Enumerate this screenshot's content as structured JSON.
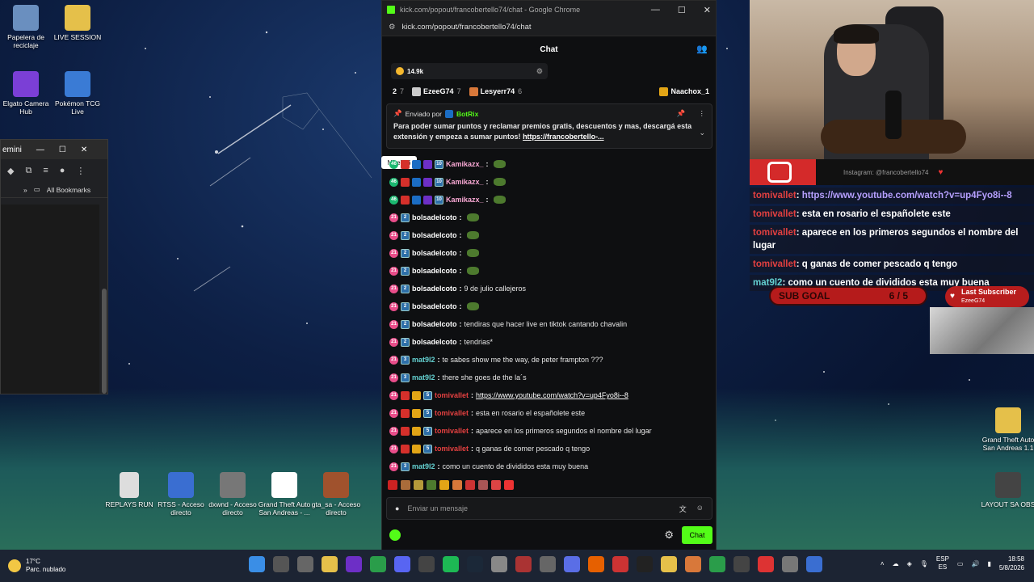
{
  "desktop": {
    "icons_left": [
      {
        "label": "Papelera de reciclaje",
        "color": "#6a8fbf"
      },
      {
        "label": "LIVE SESSION",
        "color": "#e5c04a"
      },
      {
        "label": "Elgato Camera Hub",
        "color": "#7b3fd6"
      },
      {
        "label": "Pokémon TCG Live",
        "color": "#3a7bd5"
      }
    ],
    "icons_bottom": [
      {
        "label": "REPLAYS RUN",
        "color": "#dddddd"
      },
      {
        "label": "RTSS - Acceso directo",
        "color": "#3a6ed1"
      },
      {
        "label": "dxwnd - Acceso directo",
        "color": "#777777"
      },
      {
        "label": "Grand Theft Auto San Andreas - ...",
        "color": "#ffffff"
      },
      {
        "label": "gta_sa - Acceso directo",
        "color": "#a0522d"
      }
    ],
    "icons_right": [
      {
        "label": "Grand Theft Auto San Andreas 1.1",
        "color": "#e5c04a"
      },
      {
        "label": "LAYOUT SA OBS",
        "color": "#444444"
      }
    ]
  },
  "left_browser": {
    "tab_label": "emini",
    "minimize": "—",
    "maximize": "☐",
    "close": "✕",
    "bookmarks_label": "All Bookmarks"
  },
  "chat_window": {
    "title": "kick.com/popout/francobertello74/chat - Google Chrome",
    "url": "kick.com/popout/francobertello74/chat",
    "header": "Chat",
    "points_pill": "14.9k",
    "leaderboard": [
      {
        "rank": "2",
        "name": "",
        "count": "7",
        "badge_color": "#888"
      },
      {
        "rank": "",
        "name": "EzeeG74",
        "count": "7",
        "badge_color": "#ccc"
      },
      {
        "rank": "",
        "name": "Lesyerr74",
        "count": "6",
        "badge_color": "#d8783a"
      },
      {
        "rank": "",
        "name": "Naachox_1",
        "count": "",
        "badge_color": "#e2a516"
      }
    ],
    "pinned": {
      "sent_by_label": "Enviado por",
      "sender": "BotRix",
      "message": "Para poder sumar puntos y reclamar premios gratis, descuentos y mas, descargá esta extensión y empeza a sumar puntos!",
      "link": "https://francobertello-..."
    },
    "tooltip": "Nivel 46",
    "messages": [
      {
        "user": "Kamikazx_",
        "color": "#f9a8d4",
        "text": "",
        "emote": true,
        "level": "10",
        "b1": "b-green",
        "b1t": "46"
      },
      {
        "user": "Kamikazx_",
        "color": "#f9a8d4",
        "text": "",
        "emote": true,
        "level": "10",
        "b1": "b-green",
        "b1t": "46"
      },
      {
        "user": "Kamikazx_",
        "color": "#f9a8d4",
        "text": "",
        "emote": true,
        "level": "10",
        "b1": "b-green",
        "b1t": "46"
      },
      {
        "user": "bolsadelcoto",
        "color": "#ffffff",
        "text": "",
        "emote": true,
        "level": "2",
        "b1": "b-pink",
        "b1t": "21"
      },
      {
        "user": "bolsadelcoto",
        "color": "#ffffff",
        "text": "",
        "emote": true,
        "level": "2",
        "b1": "b-pink",
        "b1t": "21"
      },
      {
        "user": "bolsadelcoto",
        "color": "#ffffff",
        "text": "",
        "emote": true,
        "level": "2",
        "b1": "b-pink",
        "b1t": "21"
      },
      {
        "user": "bolsadelcoto",
        "color": "#ffffff",
        "text": "",
        "emote": true,
        "level": "2",
        "b1": "b-pink",
        "b1t": "21"
      },
      {
        "user": "bolsadelcoto",
        "color": "#ffffff",
        "text": "9 de julio callejeros",
        "emote": false,
        "level": "2",
        "b1": "b-pink",
        "b1t": "21"
      },
      {
        "user": "bolsadelcoto",
        "color": "#ffffff",
        "text": "",
        "emote": true,
        "level": "2",
        "b1": "b-pink",
        "b1t": "21"
      },
      {
        "user": "bolsadelcoto",
        "color": "#ffffff",
        "text": "tendiras que hacer live en tiktok cantando chavalin",
        "emote": false,
        "level": "2",
        "b1": "b-pink",
        "b1t": "21"
      },
      {
        "user": "bolsadelcoto",
        "color": "#ffffff",
        "text": "tendrias*",
        "emote": false,
        "level": "2",
        "b1": "b-pink",
        "b1t": "21"
      },
      {
        "user": "mat9l2",
        "color": "#64d1d1",
        "text": "te sabes show me the way, de peter frampton ???",
        "emote": false,
        "level": "3",
        "b1": "b-pink",
        "b1t": "21"
      },
      {
        "user": "mat9l2",
        "color": "#64d1d1",
        "text": "there she goes de the la´s",
        "emote": false,
        "level": "3",
        "b1": "b-pink",
        "b1t": "21"
      },
      {
        "user": "tomivallet",
        "color": "#e34040",
        "text": "",
        "link": "https://www.youtube.com/watch?v=up4Fyo8i--8",
        "emote": false,
        "level": "5",
        "b1": "b-pink",
        "b1t": "21"
      },
      {
        "user": "tomivallet",
        "color": "#e34040",
        "text": "esta en rosario el españolete este",
        "emote": false,
        "level": "5",
        "b1": "b-pink",
        "b1t": "21"
      },
      {
        "user": "tomivallet",
        "color": "#e34040",
        "text": "aparece en los primeros segundos el nombre del lugar",
        "emote": false,
        "level": "5",
        "b1": "b-pink",
        "b1t": "21"
      },
      {
        "user": "tomivallet",
        "color": "#e34040",
        "text": "q ganas de comer pescado q tengo",
        "emote": false,
        "level": "5",
        "b1": "b-pink",
        "b1t": "21"
      },
      {
        "user": "mat9l2",
        "color": "#64d1d1",
        "text": "como un cuento de divididos esta muy buena",
        "emote": false,
        "level": "3",
        "b1": "b-pink",
        "b1t": "21"
      }
    ],
    "input_placeholder": "Enviar un mensaje",
    "send_label": "Chat"
  },
  "stream_overlay": {
    "instagram": "Instagram: @francobertello74",
    "chat": [
      {
        "user": "tomivallet",
        "text": "",
        "link": "https://www.youtube.com/watch?v=up4Fyo8i--8"
      },
      {
        "user": "tomivallet",
        "text": "esta en rosario el españolete este"
      },
      {
        "user": "tomivallet",
        "text": "aparece en los primeros segundos el nombre del lugar"
      },
      {
        "user": "tomivallet",
        "text": "q ganas de comer pescado q tengo"
      },
      {
        "user": "mat9l2",
        "text": "como un cuento de divididos esta muy buena"
      }
    ],
    "sub_goal_label": "SUB GOAL",
    "sub_goal_value": "6 / 5",
    "last_subscriber_label": "Last Subscriber",
    "last_subscriber_name": "EzeeG74"
  },
  "taskbar": {
    "temp": "17°C",
    "weather": "Parc. nublado",
    "lang_top": "ESP",
    "lang_bottom": "ES",
    "time": "18:58",
    "date": "5/8/2026"
  }
}
